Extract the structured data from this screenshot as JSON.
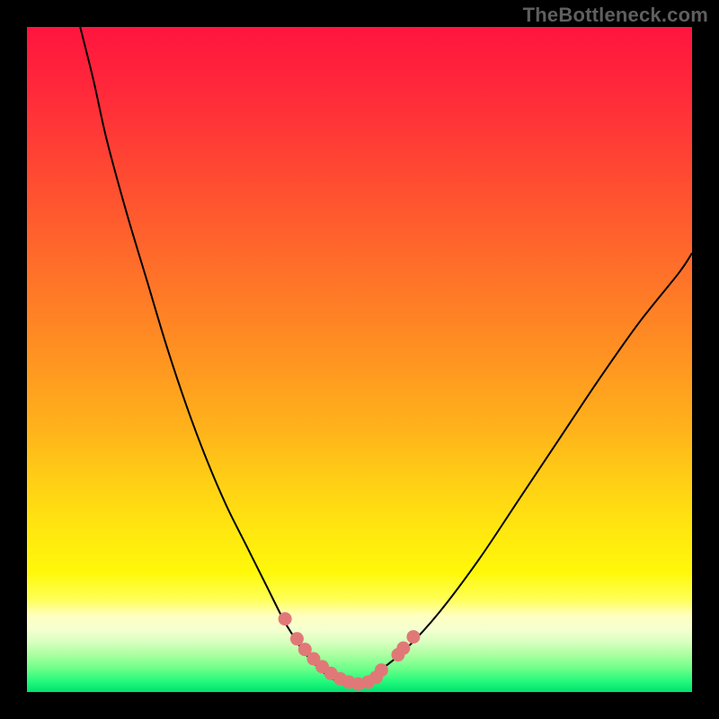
{
  "watermark": "TheBottleneck.com",
  "colors": {
    "black": "#000000",
    "marker_fill": "#e17878",
    "marker_stroke": "#cc6666",
    "curve": "#000000"
  },
  "gradient_stops": [
    {
      "offset": 0.0,
      "color": "#ff153e"
    },
    {
      "offset": 0.1,
      "color": "#ff2a3a"
    },
    {
      "offset": 0.2,
      "color": "#ff4433"
    },
    {
      "offset": 0.3,
      "color": "#ff5e2d"
    },
    {
      "offset": 0.4,
      "color": "#ff7927"
    },
    {
      "offset": 0.5,
      "color": "#ff9421"
    },
    {
      "offset": 0.6,
      "color": "#ffb11b"
    },
    {
      "offset": 0.68,
      "color": "#ffce15"
    },
    {
      "offset": 0.76,
      "color": "#ffe80f"
    },
    {
      "offset": 0.82,
      "color": "#fff80a"
    },
    {
      "offset": 0.86,
      "color": "#ffff55"
    },
    {
      "offset": 0.885,
      "color": "#ffffc0"
    },
    {
      "offset": 0.905,
      "color": "#f5ffd0"
    },
    {
      "offset": 0.925,
      "color": "#d8ffc0"
    },
    {
      "offset": 0.945,
      "color": "#a8ff9e"
    },
    {
      "offset": 0.965,
      "color": "#6cff8a"
    },
    {
      "offset": 0.985,
      "color": "#20f87a"
    },
    {
      "offset": 1.0,
      "color": "#00e070"
    }
  ],
  "chart_data": {
    "type": "line",
    "title": "",
    "xlabel": "",
    "ylabel": "",
    "xlim": [
      0,
      100
    ],
    "ylim": [
      0,
      100
    ],
    "series": [
      {
        "name": "bottleneck-curve",
        "x": [
          8,
          10,
          12,
          15,
          18,
          21,
          24,
          27,
          30,
          33,
          36,
          38.5,
          40,
          41.5,
          43,
          45,
          47,
          48,
          49,
          50,
          53,
          57,
          62,
          68,
          74,
          80,
          86,
          92,
          98,
          100
        ],
        "y": [
          100,
          92,
          83,
          72,
          62,
          52,
          43,
          35,
          28,
          22,
          16,
          11,
          8.5,
          6.2,
          4.5,
          2.6,
          1.4,
          1.0,
          1.0,
          1.3,
          3.2,
          6.5,
          12,
          20,
          29,
          38,
          47,
          55.5,
          63,
          66
        ]
      }
    ],
    "markers": {
      "name": "highlight-points",
      "x": [
        38.8,
        40.6,
        41.8,
        43.1,
        44.4,
        45.7,
        47.1,
        48.4,
        49.8,
        51.3,
        52.5,
        53.3,
        55.8,
        56.6,
        58.1
      ],
      "y": [
        11.0,
        8.0,
        6.4,
        5.0,
        3.8,
        2.8,
        2.0,
        1.5,
        1.2,
        1.5,
        2.2,
        3.3,
        5.6,
        6.6,
        8.3
      ]
    }
  }
}
